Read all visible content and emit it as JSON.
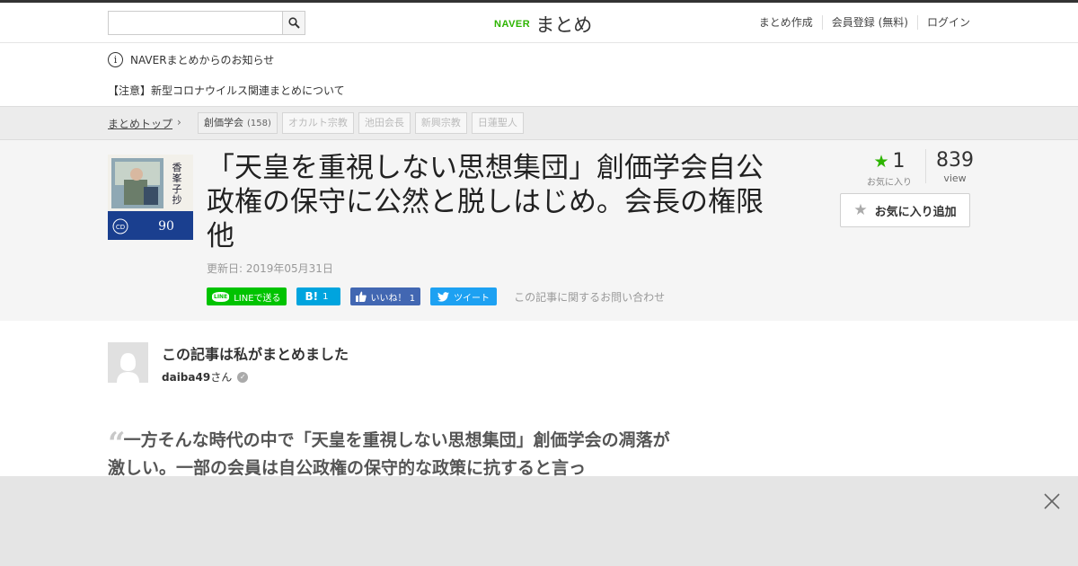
{
  "header": {
    "search_placeholder": "",
    "logo_brand": "NAVER",
    "logo_text": "まとめ",
    "nav": [
      "まとめ作成",
      "会員登録 (無料)",
      "ログイン"
    ]
  },
  "notice": {
    "info_text": "NAVERまとめからのお知らせ",
    "link_text": "【注意】新型コロナウイルス関連まとめについて"
  },
  "breadcrumb": {
    "home": "まとめトップ",
    "tags": [
      {
        "label": "創価学会",
        "count": "(158)"
      },
      {
        "label": "オカルト宗教"
      },
      {
        "label": "池田会長"
      },
      {
        "label": "新興宗教"
      },
      {
        "label": "日蓮聖人"
      }
    ]
  },
  "article": {
    "title": "「天皇を重視しない思想集団」創価学会自公政権の保守に公然と脱しはじめ。会長の権限 他",
    "updated": "更新日: 2019年05月31日",
    "share": {
      "line": "LINEで送る",
      "hatena": "1",
      "facebook": "いいね！ 1",
      "twitter": "ツイート",
      "inquiry": "この記事に関するお問い合わせ"
    },
    "favorites": {
      "count": "1",
      "label": "お気に入り"
    },
    "views": {
      "count": "839",
      "label": "view"
    },
    "fav_button": "お気に入り追加"
  },
  "author": {
    "heading": "この記事は私がまとめました",
    "username": "daiba49",
    "suffix": "さん"
  },
  "quote": {
    "text": "一方そんな時代の中で「天皇を重視しない思想集団」創価学会の凋落が激しい。一部の会員は自公政権の保守的な政策に抗すると言っ"
  },
  "colors": {
    "naver_green": "#2db400",
    "line_green": "#00c300",
    "hatena_blue": "#00a4de",
    "facebook_blue": "#4267b2",
    "twitter_blue": "#1da1f2"
  }
}
